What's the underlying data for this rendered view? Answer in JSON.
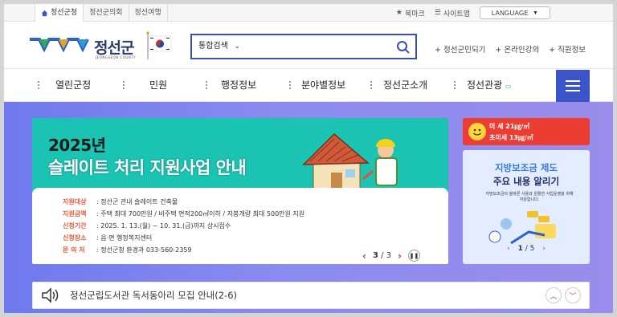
{
  "utility": {
    "tabs": [
      "정선군청",
      "정선군의회",
      "정선여행"
    ],
    "bookmark": "북마크",
    "sitemap": "사이트맵",
    "language": "LANGUAGE"
  },
  "header": {
    "logo_name": "정선군",
    "logo_eng": "JEONGSEON COUNTY",
    "search_scope": "통합검색",
    "links": [
      "+ 정선군민되기",
      "+ 온라인강의",
      "+ 직원정보"
    ]
  },
  "gnb": {
    "items": [
      "열린군정",
      "민원",
      "행정정보",
      "분야별정보",
      "정선군소개",
      "정선관광"
    ]
  },
  "banner": {
    "year_title": "2025년",
    "main_title": "슬레이트 처리 지원사업 안내",
    "rows": [
      {
        "k": "지원대상",
        "v": ": 정선군 관내 슬레이트 건축물"
      },
      {
        "k": "지원금액",
        "v": ": 주택 최대 700만원 / 비주택 면적200㎡이하 / 지붕개량 최대 500만원 지원"
      },
      {
        "k": "신청기간",
        "v": ": 2025. 1. 13.(월) ~ 10. 31.(금)까지 상시접수"
      },
      {
        "k": "신청장소",
        "v": ": 읍·면 행정복지센터"
      },
      {
        "k": "문 의 처",
        "v": ": 정선군청 환경과 033-560-2359"
      }
    ],
    "page": "3",
    "total": "/ 3"
  },
  "air": {
    "pm10": "미 세 21㎍/㎥",
    "pm25": "초미세 13㎍/㎥"
  },
  "side": {
    "title1": "지방보조금 제도",
    "title2": "주요 내용 알리기",
    "desc": "지방보조금의 올바른 사용과 원활한 사업운영을 위해 지원합니다.",
    "page": "1",
    "total": "/ 5"
  },
  "notice": {
    "text": "정선군립도서관 독서동아리 모집 안내(2-6)"
  },
  "colors": {
    "accent": "#3b54c8",
    "banner": "#1bc4b2",
    "air": "#ec3d33"
  }
}
